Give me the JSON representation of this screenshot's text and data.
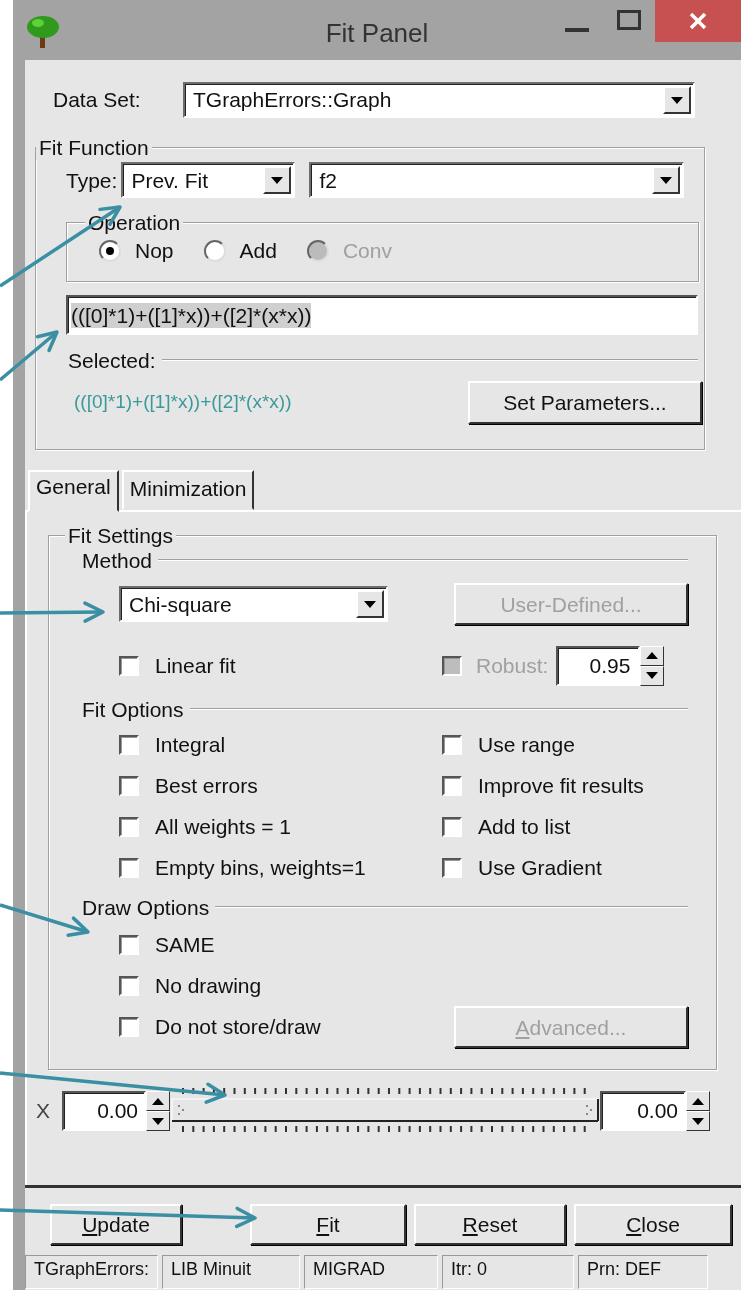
{
  "window": {
    "title": "Fit Panel"
  },
  "data_set": {
    "label": "Data Set:",
    "value": "TGraphErrors::Graph"
  },
  "fit_function": {
    "title": "Fit Function",
    "type_label": "Type:",
    "type_value": "Prev. Fit",
    "function_value": "f2",
    "operation": {
      "title": "Operation",
      "options": [
        {
          "label": "Nop",
          "selected": true,
          "disabled": false
        },
        {
          "label": "Add",
          "selected": false,
          "disabled": false
        },
        {
          "label": "Conv",
          "selected": false,
          "disabled": true
        }
      ]
    },
    "formula": {
      "value": "(([0]*1)+([1]*x))+([2]*(x*x))",
      "text_selected": true
    },
    "selected_label": "Selected:",
    "selected_formula": "(([0]*1)+([1]*x))+([2]*(x*x))",
    "set_parameters_button": {
      "label": "Set Parameters...",
      "disabled": false,
      "mnemonic": false
    }
  },
  "tabs": [
    {
      "label": "General",
      "selected": true
    },
    {
      "label": "Minimization",
      "selected": false
    }
  ],
  "fit_settings": {
    "title": "Fit Settings",
    "method_label": "Method",
    "method_value": "Chi-square",
    "user_defined_button": {
      "label": "User-Defined...",
      "disabled": true,
      "mnemonic": false
    },
    "linear_fit": {
      "label": "Linear fit",
      "checked": false,
      "disabled": false
    },
    "robust": {
      "label": "Robust:",
      "checked": false,
      "disabled": true,
      "value": "0.95"
    },
    "fit_options_label": "Fit Options",
    "fit_options": [
      {
        "label": "Integral",
        "checked": false,
        "disabled": false
      },
      {
        "label": "Use range",
        "checked": false,
        "disabled": false
      },
      {
        "label": "Best errors",
        "checked": false,
        "disabled": false
      },
      {
        "label": "Improve fit results",
        "checked": false,
        "disabled": false
      },
      {
        "label": "All weights = 1",
        "checked": false,
        "disabled": false
      },
      {
        "label": "Add to list",
        "checked": false,
        "disabled": false
      },
      {
        "label": "Empty bins, weights=1",
        "checked": false,
        "disabled": false
      },
      {
        "label": "Use Gradient",
        "checked": false,
        "disabled": false
      }
    ],
    "draw_options_label": "Draw Options",
    "draw_options": [
      {
        "label": "SAME",
        "checked": false,
        "disabled": false
      },
      {
        "label": "No drawing",
        "checked": false,
        "disabled": false
      },
      {
        "label": "Do not store/draw",
        "checked": false,
        "disabled": false
      }
    ],
    "advanced_button": {
      "label": "Advanced...",
      "disabled": true,
      "mnemonic": true
    }
  },
  "range": {
    "label": "X",
    "min": "0.00",
    "max": "0.00",
    "slider": {
      "level": 1
    }
  },
  "buttons": [
    {
      "label": "Update",
      "disabled": false,
      "mnemonic": true
    },
    {
      "label": "Fit",
      "disabled": false,
      "mnemonic": true
    },
    {
      "label": "Reset",
      "disabled": false,
      "mnemonic": true
    },
    {
      "label": "Close",
      "disabled": false,
      "mnemonic": true
    }
  ],
  "status_bar": [
    "TGraphErrors:",
    "LIB Minuit",
    "MIGRAD",
    "Itr: 0",
    "Prn: DEF"
  ]
}
